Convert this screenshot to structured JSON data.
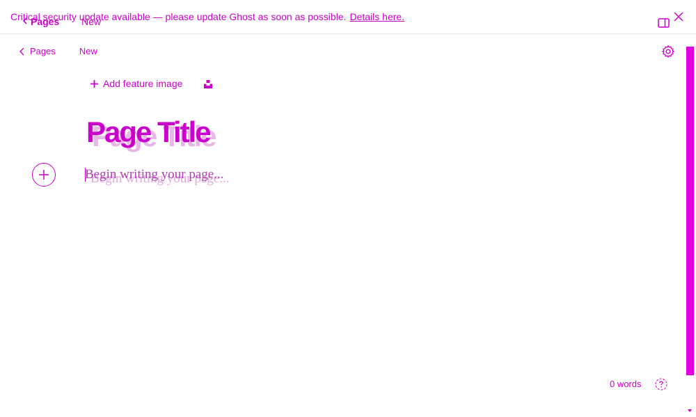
{
  "banner": {
    "message": "Critical security update available — please update Ghost as soon as possible.",
    "link_label": "Details here.",
    "behind_pages": "Pages",
    "behind_new": "New"
  },
  "breadcrumb": {
    "back_label": "Pages",
    "status": "New"
  },
  "editor": {
    "feature_image_label": "Add feature image",
    "title_placeholder": "Page Title",
    "body_placeholder": "Begin writing your page..."
  },
  "footer": {
    "word_count": "0 words"
  },
  "icons": {
    "close": "close-icon",
    "sidebar_toggle": "sidebar-toggle-icon",
    "settings": "gear-icon",
    "back": "chevron-left-icon",
    "plus": "plus-icon",
    "unsplash": "unsplash-icon",
    "card_add": "plus-circle-icon",
    "help": "help-icon"
  },
  "colors": {
    "accent": "#cc00cc",
    "scrollbar": "#e000e0",
    "banner_border": "#e6e6e6"
  }
}
